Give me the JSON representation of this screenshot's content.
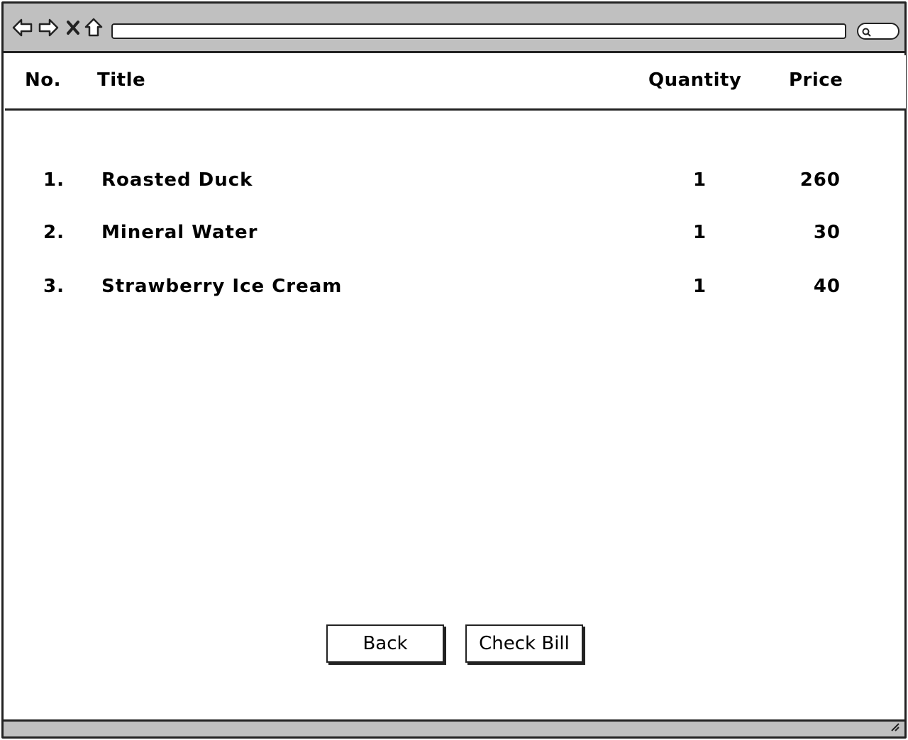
{
  "browser": {
    "nav_icons": [
      "back-arrow-icon",
      "forward-arrow-icon",
      "close-x-icon",
      "home-icon"
    ],
    "address_value": "",
    "search_icon": "search-icon"
  },
  "table": {
    "headers": {
      "number": "No.",
      "title": "Title",
      "quantity": "Quantity",
      "price": "Price"
    },
    "rows": [
      {
        "number": "1.",
        "title": "Roasted Duck",
        "quantity": "1",
        "price": "260"
      },
      {
        "number": "2.",
        "title": "Mineral Water",
        "quantity": "1",
        "price": "30"
      },
      {
        "number": "3.",
        "title": "Strawberry Ice Cream",
        "quantity": "1",
        "price": "40"
      }
    ]
  },
  "actions": {
    "back_label": "Back",
    "check_bill_label": "Check Bill"
  },
  "colors": {
    "chrome": "#c0c0c0",
    "border": "#222222",
    "background": "#ffffff"
  }
}
